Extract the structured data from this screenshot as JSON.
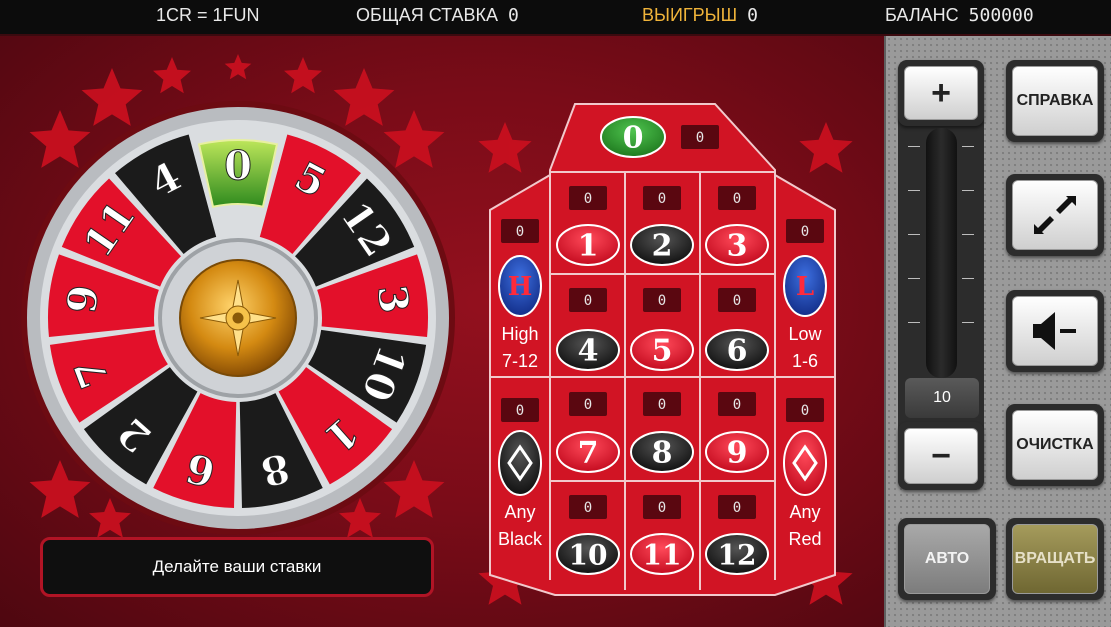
{
  "topbar": {
    "rate": "1CR = 1FUN",
    "total_bet_label": "ОБЩАЯ СТАВКА",
    "total_bet_value": "0",
    "win_label": "ВЫИГРЫШ",
    "win_value": "0",
    "balance_label": "БАЛАНС",
    "balance_value": "500000"
  },
  "wheel": {
    "numbers": [
      "0",
      "5",
      "12",
      "3",
      "10",
      "1",
      "8",
      "6",
      "2",
      "7",
      "9",
      "11",
      "4"
    ]
  },
  "message": "Делайте ваши ставки",
  "board": {
    "zero": "0",
    "zero_bet": "0",
    "cells": [
      {
        "n": "1",
        "bet": "0",
        "color": "red"
      },
      {
        "n": "2",
        "bet": "0",
        "color": "black"
      },
      {
        "n": "3",
        "bet": "0",
        "color": "red"
      },
      {
        "n": "4",
        "bet": "0",
        "color": "black"
      },
      {
        "n": "5",
        "bet": "0",
        "color": "red"
      },
      {
        "n": "6",
        "bet": "0",
        "color": "black"
      },
      {
        "n": "7",
        "bet": "0",
        "color": "red"
      },
      {
        "n": "8",
        "bet": "0",
        "color": "black"
      },
      {
        "n": "9",
        "bet": "0",
        "color": "red"
      },
      {
        "n": "10",
        "bet": "0",
        "color": "black"
      },
      {
        "n": "11",
        "bet": "0",
        "color": "red"
      },
      {
        "n": "12",
        "bet": "0",
        "color": "black"
      }
    ],
    "high": {
      "symbol": "H",
      "line1": "High",
      "line2": "7-12",
      "bet": "0"
    },
    "low": {
      "symbol": "L",
      "line1": "Low",
      "line2": "1-6",
      "bet": "0"
    },
    "black": {
      "line1": "Any",
      "line2": "Black",
      "bet": "0"
    },
    "red": {
      "line1": "Any",
      "line2": "Red",
      "bet": "0"
    }
  },
  "controls": {
    "plus": "+",
    "minus": "−",
    "bet_value": "10",
    "help": "СПРАВКА",
    "clear": "ОЧИСТКА",
    "auto": "АВТО",
    "spin": "ВРАЩАТЬ",
    "fullscreen_icon": "expand-arrows-icon",
    "sound_icon": "speaker-mute-icon"
  },
  "colors": {
    "red": "#e3102a",
    "black": "#1b1b1b",
    "green": "#2e9a2e",
    "felt": "#b3111f",
    "gold": "#f0b43a"
  }
}
